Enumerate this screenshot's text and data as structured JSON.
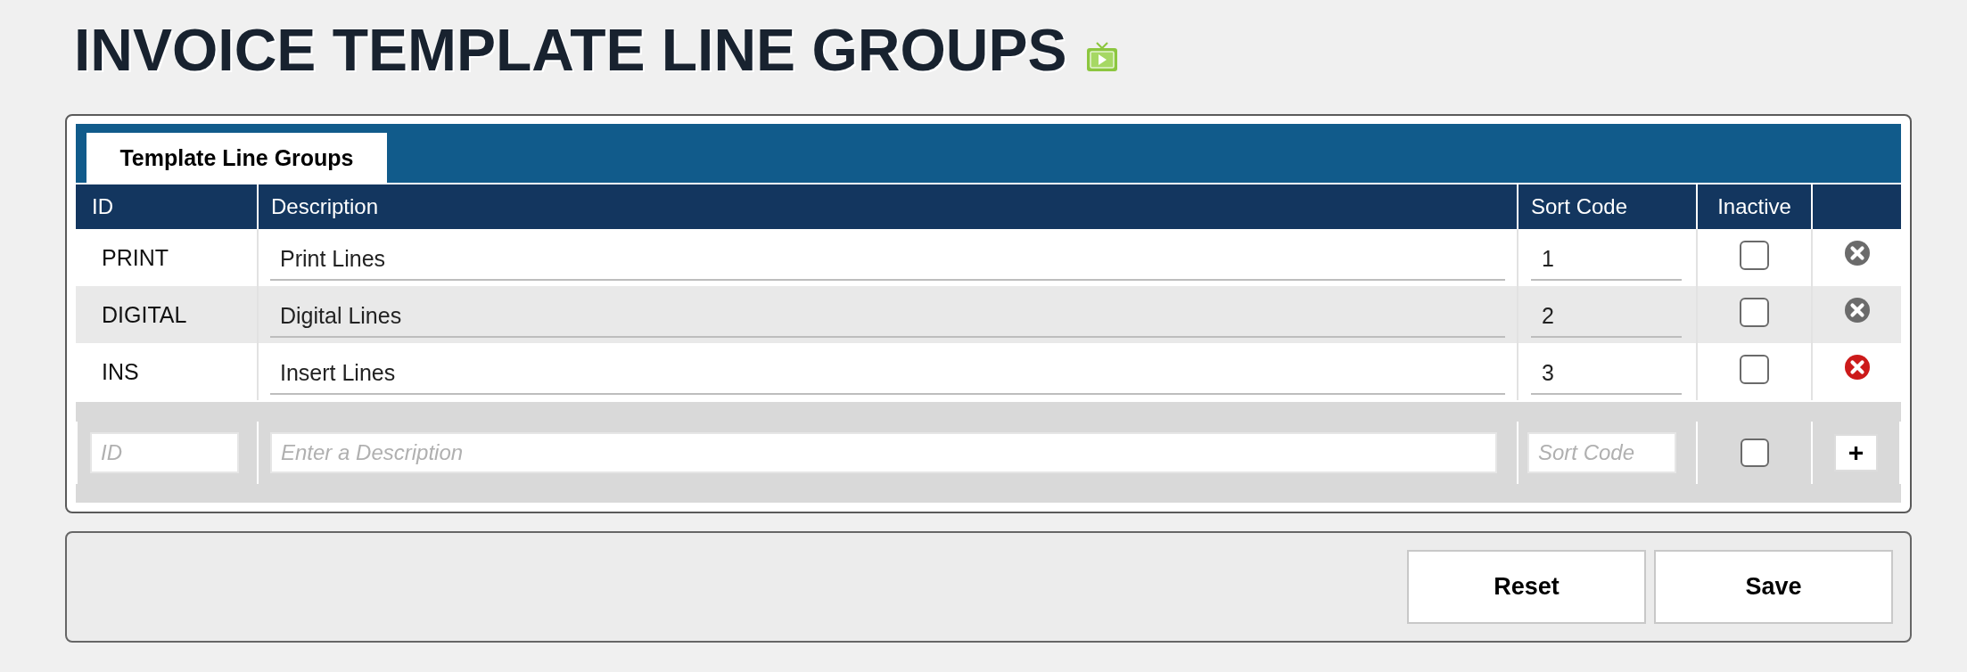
{
  "page": {
    "title": "INVOICE TEMPLATE LINE GROUPS"
  },
  "tabs": [
    {
      "label": "Template Line Groups",
      "selected": true
    }
  ],
  "table": {
    "columns": [
      "ID",
      "Description",
      "Sort Code",
      "Inactive"
    ],
    "rows": [
      {
        "id": "PRINT",
        "description": "Print Lines",
        "sort_code": "1",
        "inactive": false,
        "remove_highlighted": false
      },
      {
        "id": "DIGITAL",
        "description": "Digital Lines",
        "sort_code": "2",
        "inactive": false,
        "remove_highlighted": false
      },
      {
        "id": "INS",
        "description": "Insert Lines",
        "sort_code": "3",
        "inactive": false,
        "remove_highlighted": true
      }
    ],
    "new_row": {
      "id": {
        "placeholder": "ID"
      },
      "description": {
        "placeholder": "Enter a Description"
      },
      "sort_code": {
        "placeholder": "Sort Code"
      },
      "inactive": false,
      "add_button": "+"
    }
  },
  "buttons": [
    "Reset",
    "Save"
  ]
}
